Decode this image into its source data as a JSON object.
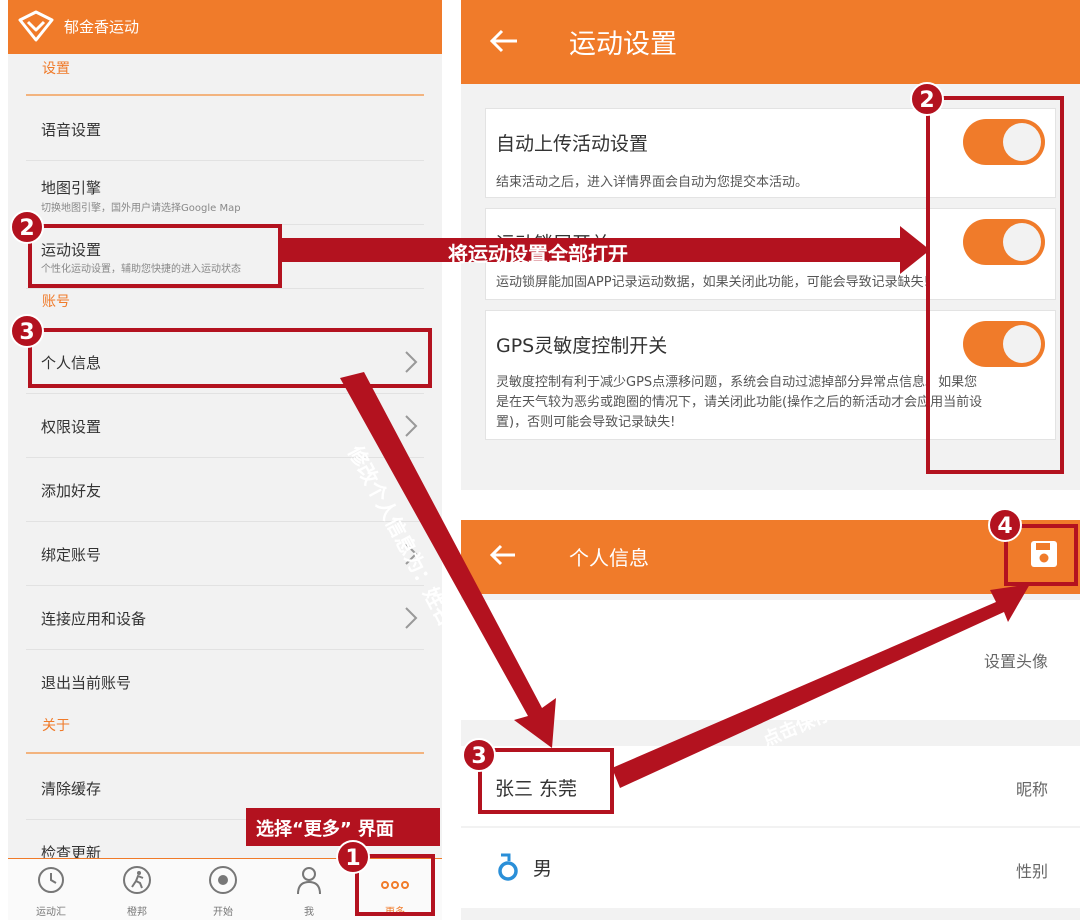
{
  "left": {
    "app_title": "郁金香运动",
    "section_settings": "设置",
    "items": [
      {
        "title": "语音设置"
      },
      {
        "title": "地图引擎",
        "subtitle": "切换地图引擎，国外用户请选择Google Map"
      },
      {
        "title": "运动设置",
        "subtitle": "个性化运动设置，辅助您快捷的进入运动状态"
      },
      {
        "title": "个人信息"
      },
      {
        "title": "权限设置"
      },
      {
        "title": "添加好友"
      },
      {
        "title": "绑定账号"
      },
      {
        "title": "连接应用和设备"
      },
      {
        "title": "退出当前账号"
      },
      {
        "title": "清除缓存"
      },
      {
        "title": "检查更新"
      }
    ],
    "section_account": "账号",
    "section_about": "关于",
    "tabs": [
      "运动汇",
      "橙邦",
      "开始",
      "我",
      "更多"
    ]
  },
  "sport_settings": {
    "title": "运动设置",
    "cards": [
      {
        "title": "自动上传活动设置",
        "desc": "结束活动之后，进入详情界面会自动为您提交本活动。",
        "enabled": true
      },
      {
        "title": "运动锁屏开关",
        "desc": "运动锁屏能加固APP记录运动数据，如果关闭此功能，可能会导致记录缺失!",
        "enabled": true
      },
      {
        "title": "GPS灵敏度控制开关",
        "desc_lines": [
          "灵敏度控制有利于减少GPS点漂移问题，系统会自动过滤掉部分异常点信息。如果您",
          "是在天气较为恶劣或跑圈的情况下，请关闭此功能(操作之后的新活动才会应用当前设",
          "置)，否则可能会导致记录缺失!"
        ],
        "enabled": true
      }
    ]
  },
  "personal_info": {
    "title": "个人信息",
    "avatar_label": "设置头像",
    "name_value": "张三 东莞",
    "name_label": "昵称",
    "gender_value": "男",
    "gender_label": "性别"
  },
  "annotations": {
    "step1": "1",
    "step2": "2",
    "step3": "3",
    "step4": "4",
    "select_more": "选择“更多” 界面",
    "open_all": "将运动设置全部打开",
    "modify_info": "修改个人信息为：姓名+地区",
    "click_save": "点击保存",
    "accent_color": "#b3121f",
    "brand_color": "#f07b2a"
  }
}
